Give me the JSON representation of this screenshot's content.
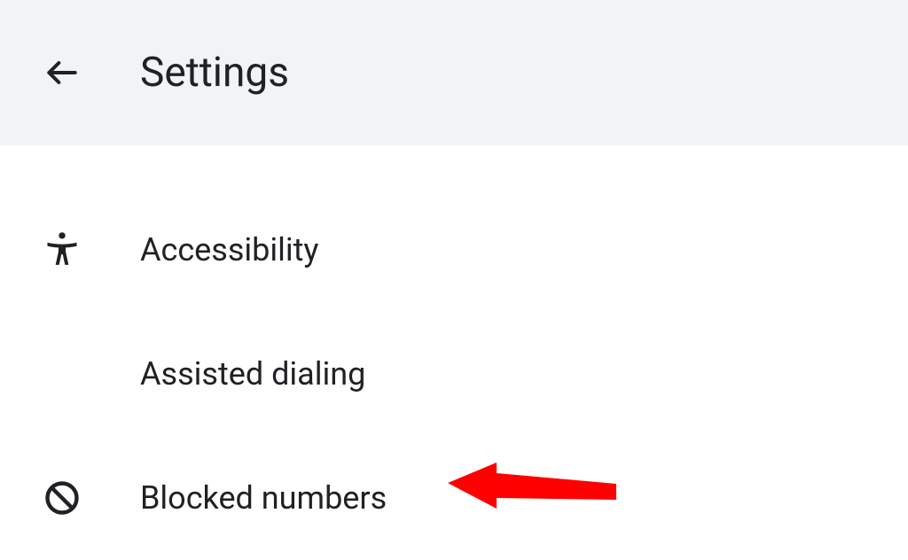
{
  "header": {
    "title": "Settings"
  },
  "items": [
    {
      "label": "Accessibility",
      "icon": "accessibility-icon"
    },
    {
      "label": "Assisted dialing",
      "icon": ""
    },
    {
      "label": "Blocked numbers",
      "icon": "block-icon"
    }
  ],
  "annotation": {
    "type": "arrow",
    "color": "#ff0000",
    "target": "blocked-numbers"
  }
}
